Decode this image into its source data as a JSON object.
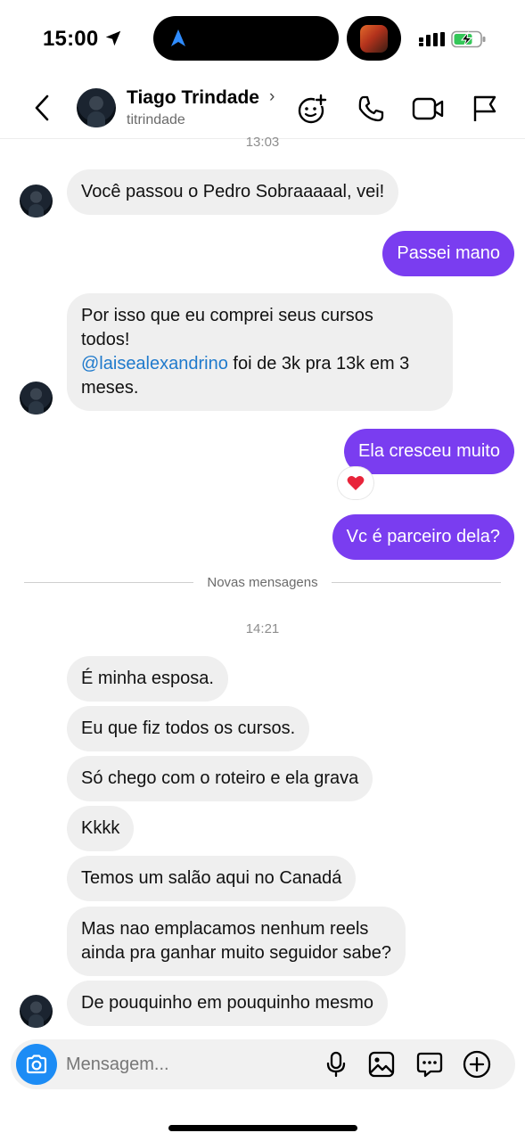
{
  "status_bar": {
    "time": "15:00"
  },
  "header": {
    "contact_name": "Tiago Trindade",
    "username": "titrindade",
    "icons": [
      "back-icon",
      "add-effect-icon",
      "phone-icon",
      "video-icon",
      "flag-icon"
    ]
  },
  "chat": {
    "timestamp_top": "13:03",
    "messages_before": [
      {
        "from": "them",
        "text": "Você passou o Pedro Sobraaaaal, vei!"
      },
      {
        "from": "me",
        "text": "Passei mano"
      },
      {
        "from": "them",
        "text_line1": "Por isso que eu comprei seus cursos",
        "text_line2": "todos!",
        "mention": "@laisealexandrino",
        "text_after_mention": " foi de 3k pra 13k em 3",
        "text_line4": "meses."
      },
      {
        "from": "me",
        "text": "Ela cresceu muito",
        "reaction": "❤️"
      },
      {
        "from": "me",
        "text": "Vc é parceiro dela?"
      }
    ],
    "new_messages_label": "Novas mensagens",
    "timestamp_new": "14:21",
    "messages_after": [
      {
        "from": "them",
        "text": "É minha esposa."
      },
      {
        "from": "them",
        "text": "Eu que fiz todos os cursos."
      },
      {
        "from": "them",
        "text": "Só chego com o roteiro e ela grava"
      },
      {
        "from": "them",
        "text": "Kkkk"
      },
      {
        "from": "them",
        "text": "Temos um salão aqui no Canadá"
      },
      {
        "from": "them",
        "text": "Mas nao emplacamos nenhum reels\nainda  pra ganhar muito seguidor sabe?"
      },
      {
        "from": "them",
        "text": "De pouquinho em pouquinho mesmo"
      }
    ]
  },
  "composer": {
    "placeholder": "Mensagem...",
    "icons": [
      "camera-icon",
      "microphone-icon",
      "gallery-icon",
      "sticker-icon",
      "plus-icon"
    ],
    "camera_color": "#1c8cf5"
  },
  "colors": {
    "outgoing_bubble": "#7a3df0",
    "incoming_bubble": "#efefef",
    "mention": "#1f7acc"
  }
}
